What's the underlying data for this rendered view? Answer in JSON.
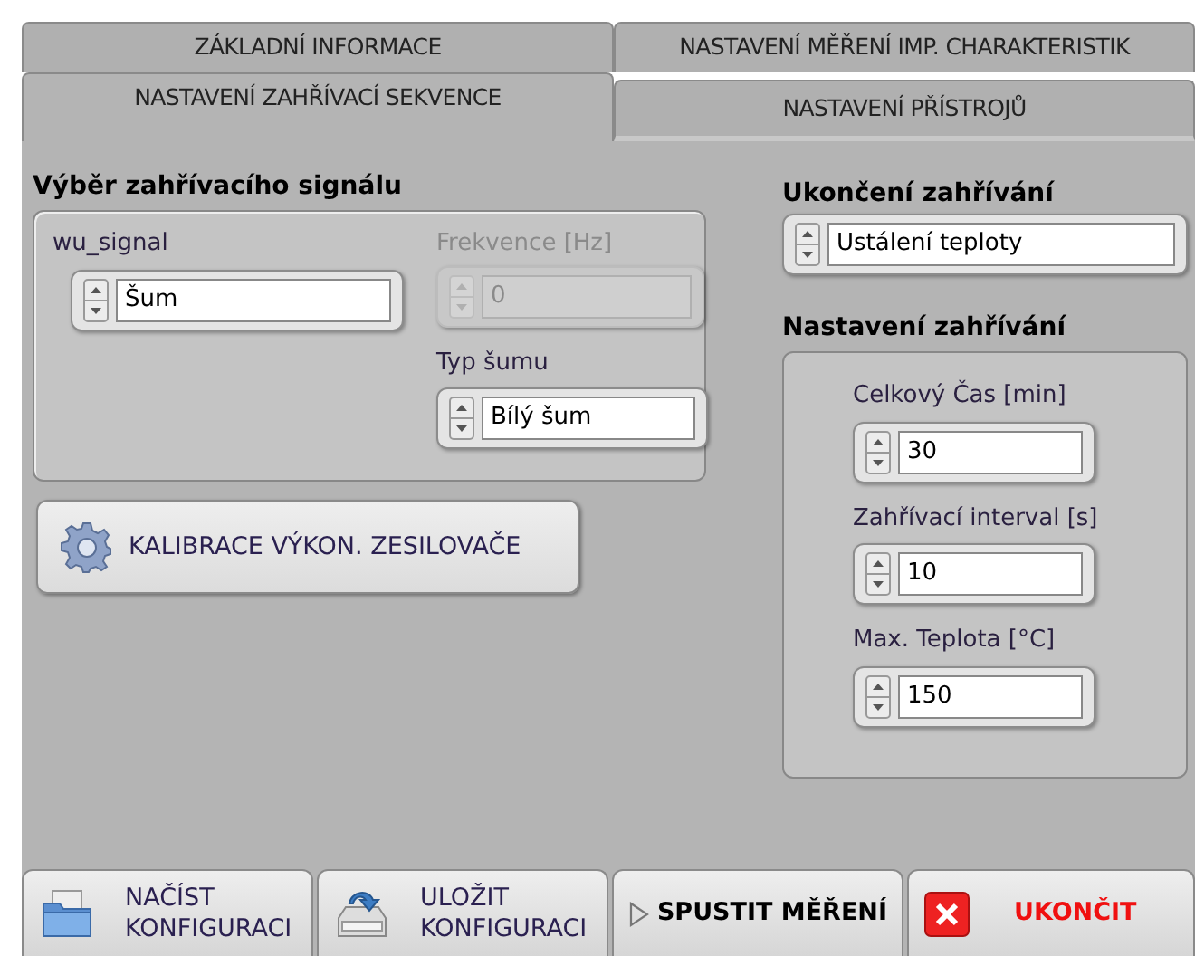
{
  "tabs": [
    [
      {
        "label": "ZÁKLADNÍ INFORMACE",
        "selected": false
      },
      {
        "label": "NASTAVENÍ MĚŘENÍ IMP. CHARAKTERISTIK",
        "selected": false
      }
    ],
    [
      {
        "label": "NASTAVENÍ ZAHŘÍVACÍ SEKVENCE",
        "selected": true
      },
      {
        "label": "NASTAVENÍ PŘÍSTROJŮ",
        "selected": false
      }
    ]
  ],
  "signal_group": {
    "title": "Výběr zahřívacího signálu",
    "wu_signal": {
      "label": "wu_signal",
      "value": "Šum",
      "disabled": false
    },
    "frequency": {
      "label": "Frekvence [Hz]",
      "value": "0",
      "disabled": true
    },
    "noise_type": {
      "label": "Typ šumu",
      "value": "Bílý šum",
      "disabled": false
    }
  },
  "calibrate_button": "KALIBRACE VÝKON. ZESILOVAČE",
  "end_heating": {
    "title": "Ukončení zahřívání",
    "value": "Ustálení teploty",
    "disabled": false
  },
  "heating_settings": {
    "title": "Nastavení zahřívání",
    "controls": [
      {
        "label": "Celkový Čas [min]",
        "value": "30",
        "disabled": false
      },
      {
        "label": "Zahřívací interval [s]",
        "value": "10",
        "disabled": false
      },
      {
        "label": "Max. Teplota [°C]",
        "value": "150",
        "disabled": false
      }
    ]
  },
  "bottom_buttons": [
    {
      "kind": "load",
      "lines": [
        "NAČÍST",
        "KONFIGURACI"
      ]
    },
    {
      "kind": "save",
      "lines": [
        "ULOŽIT",
        "KONFIGURACI"
      ]
    },
    {
      "kind": "run",
      "lines": [
        "SPUSTIT MĚŘENÍ"
      ]
    },
    {
      "kind": "exit",
      "lines": [
        "UKONČIT"
      ]
    }
  ]
}
